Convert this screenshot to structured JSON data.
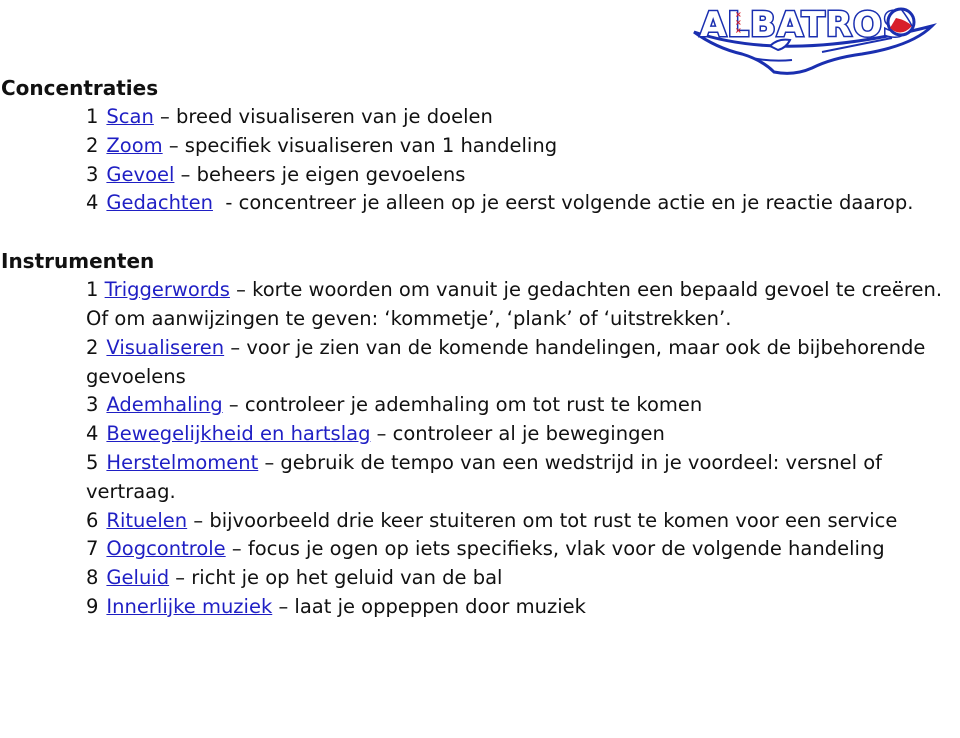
{
  "logo": {
    "text": "ALBATROS",
    "colors": {
      "blue": "#1a2fb0",
      "red": "#d81e2a",
      "white": "#ffffff"
    }
  },
  "link_color": "#1f1fc4",
  "sections": [
    {
      "title": "Concentraties",
      "items": [
        {
          "num": "1",
          "link": "Scan",
          "sep": " – ",
          "text": "breed visualiseren van je doelen"
        },
        {
          "num": "2",
          "link": "Zoom",
          "sep": " – ",
          "text": "specifiek visualiseren van 1 handeling"
        },
        {
          "num": "3",
          "link": "Gevoel",
          "sep": " – ",
          "text": "beheers je eigen gevoelens"
        },
        {
          "num": "4",
          "link": "Gedachten",
          "sep": "  - ",
          "text": "concentreer je alleen op je eerst volgende actie en je reactie daarop."
        }
      ]
    },
    {
      "title": "Instrumenten",
      "items": [
        {
          "num": "1",
          "link": "Triggerwords",
          "sep": " – ",
          "text": "korte woorden om vanuit je gedachten een bepaald gevoel te creëren. Of om aanwijzingen te geven: ‘kommetje’, ‘plank’ of ‘uitstrekken’."
        },
        {
          "num": "2",
          "link": "Visualiseren",
          "sep": " – ",
          "text": "voor je zien van de komende handelingen, maar ook de bijbehorende gevoelens"
        },
        {
          "num": "3",
          "link": "Ademhaling",
          "sep": " – ",
          "text": "controleer je ademhaling om tot rust te komen"
        },
        {
          "num": "4",
          "link": "Bewegelijkheid en hartslag",
          "sep": " – ",
          "text": "controleer al je bewegingen"
        },
        {
          "num": "5",
          "link": "Herstelmoment",
          "sep": " – ",
          "text": "gebruik de tempo van een wedstrijd in je voordeel: versnel of vertraag."
        },
        {
          "num": "6",
          "link": "Rituelen",
          "sep": " – ",
          "text": "bijvoorbeeld drie keer stuiteren om tot rust te komen voor een service"
        },
        {
          "num": "7",
          "link": "Oogcontrole",
          "sep": " – ",
          "text": "focus je ogen op iets specifieks, vlak voor de volgende handeling"
        },
        {
          "num": "8",
          "link": "Geluid",
          "sep": " – ",
          "text": "richt je op het geluid van de bal"
        },
        {
          "num": "9",
          "link": "Innerlijke muziek",
          "sep": " – ",
          "text": "laat je oppeppen door muziek"
        }
      ]
    }
  ]
}
